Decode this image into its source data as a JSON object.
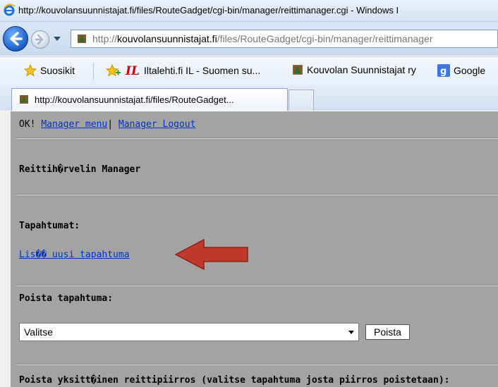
{
  "window": {
    "title": "http://kouvolansuunnistajat.fi/files/RouteGadget/cgi-bin/manager/reittimanager.cgi - Windows I"
  },
  "address_bar": {
    "domain": "kouvolansuunnistajat.fi",
    "prefix": "http://",
    "path": "/files/RouteGadget/cgi-bin/manager/reittimanager"
  },
  "favorites_bar": {
    "items": [
      {
        "label": "Suosikit",
        "icon": "star-icon"
      },
      {
        "label": "Iltalehti.fi IL - Suomen su...",
        "icon": "iltalehti-logo-icon"
      },
      {
        "label": "Kouvolan Suunnistajat ry",
        "icon": "site-icon"
      },
      {
        "label": "Google",
        "icon": "google-icon"
      }
    ]
  },
  "tab": {
    "label": "http://kouvolansuunnistajat.fi/files/RouteGadget..."
  },
  "page": {
    "status": "OK!",
    "menu_link": "Manager menu",
    "separator": "|",
    "logout_link": "Manager Logout",
    "title": "Reittih�rvelin Manager",
    "events_heading": "Tapahtumat:",
    "add_event_link": "Lis�� uusi tapahtuma",
    "delete_event_heading": "Poista tapahtuma:",
    "select_value": "Valitse",
    "delete_button": "Poista",
    "delete_route_heading": "Poista yksitt�inen reittipiirros (valitse tapahtuma josta piirros poistetaan):"
  },
  "colors": {
    "page_background": "#a3a3a3",
    "link": "#0033cc",
    "annotation_arrow": "#c0392b"
  }
}
